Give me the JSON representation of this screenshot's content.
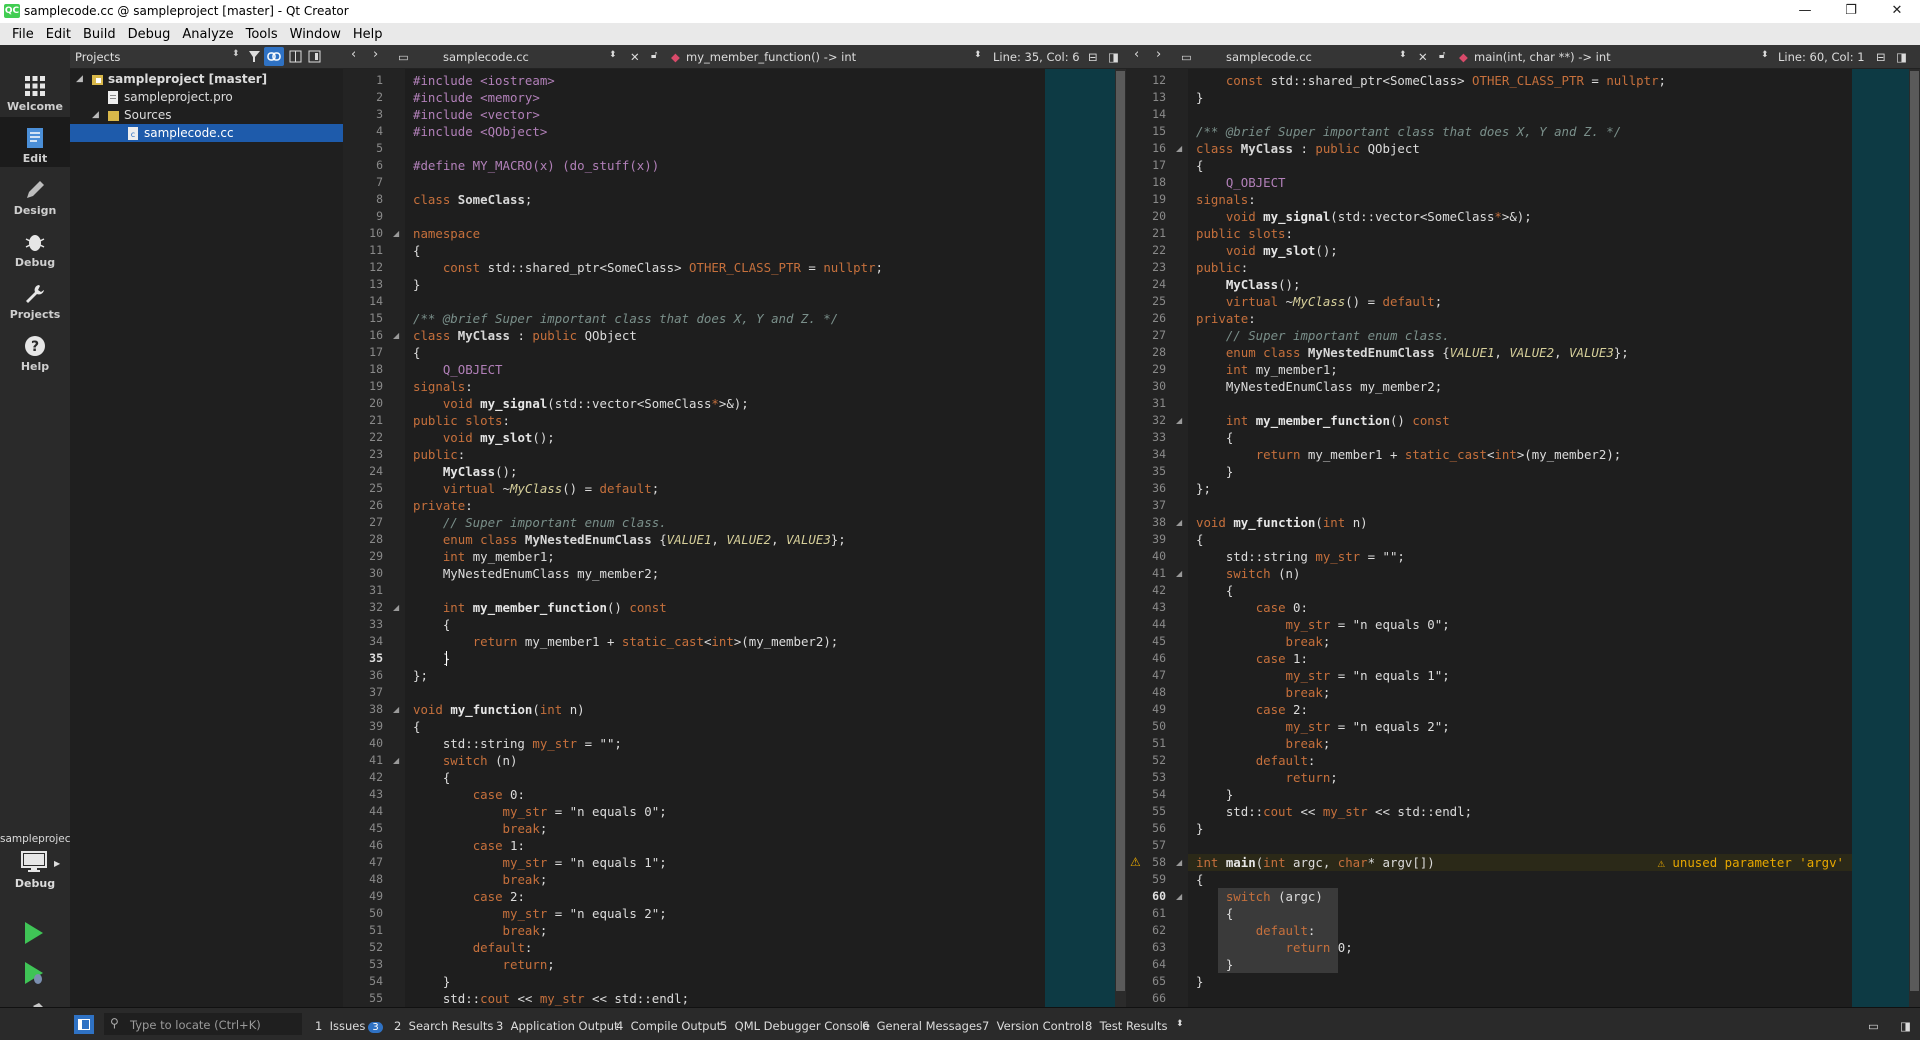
{
  "window": {
    "title": "samplecode.cc @ sampleproject [master] - Qt Creator",
    "app_icon": "QC",
    "controls": {
      "minimize": "—",
      "maximize": "❐",
      "close": "✕"
    }
  },
  "menu": [
    "File",
    "Edit",
    "Build",
    "Debug",
    "Analyze",
    "Tools",
    "Window",
    "Help"
  ],
  "modes": [
    {
      "label": "Welcome",
      "icon": "grid-icon"
    },
    {
      "label": "Edit",
      "icon": "edit-doc-icon",
      "active": true
    },
    {
      "label": "Design",
      "icon": "pencil-icon"
    },
    {
      "label": "Debug",
      "icon": "bug-icon"
    },
    {
      "label": "Projects",
      "icon": "wrench-icon"
    },
    {
      "label": "Help",
      "icon": "help-icon"
    }
  ],
  "kit": {
    "project": "sampleproject",
    "config": "Debug"
  },
  "projects_panel": {
    "title": "Projects",
    "tree": [
      {
        "label": "sampleproject [master]",
        "depth": 0,
        "bold": true,
        "expanded": true,
        "icon": "project-folder-icon"
      },
      {
        "label": "sampleproject.pro",
        "depth": 1,
        "icon": "pro-file-icon"
      },
      {
        "label": "Sources",
        "depth": 1,
        "expanded": true,
        "icon": "folder-icon"
      },
      {
        "label": "samplecode.cc",
        "depth": 2,
        "selected": true,
        "icon": "cpp-file-icon"
      }
    ]
  },
  "editors": [
    {
      "file": "samplecode.cc",
      "symbol": "my_member_function() -> int",
      "position": "Line: 35, Col: 6",
      "current_line": 35,
      "first_line": 1
    },
    {
      "file": "samplecode.cc",
      "symbol": "main(int, char **) -> int",
      "position": "Line: 60, Col: 1",
      "current_line": 60,
      "first_line": 12,
      "warning": "unused parameter 'argv'",
      "warning_line": 58
    }
  ],
  "status": {
    "locator_placeholder": "Type to locate (Ctrl+K)",
    "panes": [
      {
        "n": "1",
        "label": "Issues",
        "badge": "3"
      },
      {
        "n": "2",
        "label": "Search Results"
      },
      {
        "n": "3",
        "label": "Application Output"
      },
      {
        "n": "4",
        "label": "Compile Output"
      },
      {
        "n": "5",
        "label": "QML Debugger Console"
      },
      {
        "n": "6",
        "label": "General Messages"
      },
      {
        "n": "7",
        "label": "Version Control"
      },
      {
        "n": "8",
        "label": "Test Results"
      }
    ]
  },
  "code_lines": [
    [
      [
        "pp",
        "#include <iostream>"
      ]
    ],
    [
      [
        "pp",
        "#include <memory>"
      ]
    ],
    [
      [
        "pp",
        "#include <vector>"
      ]
    ],
    [
      [
        "pp",
        "#include <QObject>"
      ]
    ],
    [],
    [
      [
        "pp",
        "#define MY_MACRO(x) (do_stuff(x))"
      ]
    ],
    [],
    [
      [
        "k",
        "class "
      ],
      [
        "cls",
        "SomeClass"
      ],
      [
        "plain",
        ";"
      ]
    ],
    [],
    [
      [
        "k",
        "namespace"
      ]
    ],
    [
      [
        "plain",
        "{"
      ]
    ],
    [
      [
        "plain",
        "    "
      ],
      [
        "k",
        "const "
      ],
      [
        "plain",
        "std::shared_ptr<SomeClass> "
      ],
      [
        "var",
        "OTHER_CLASS_PTR"
      ],
      [
        "plain",
        " = "
      ],
      [
        "k",
        "nullptr"
      ],
      [
        "plain",
        ";"
      ]
    ],
    [
      [
        "plain",
        "}"
      ]
    ],
    [],
    [
      [
        "cm",
        "/** @brief Super important class that does X, Y and Z. */"
      ]
    ],
    [
      [
        "k",
        "class "
      ],
      [
        "cls",
        "MyClass"
      ],
      [
        "plain",
        " : "
      ],
      [
        "k",
        "public "
      ],
      [
        "plain",
        "QObject"
      ]
    ],
    [
      [
        "plain",
        "{"
      ]
    ],
    [
      [
        "plain",
        "    "
      ],
      [
        "mac",
        "Q_OBJECT"
      ]
    ],
    [
      [
        "k",
        "signals"
      ],
      [
        "plain",
        ":"
      ]
    ],
    [
      [
        "plain",
        "    "
      ],
      [
        "k",
        "void "
      ],
      [
        "fn",
        "my_signal"
      ],
      [
        "plain",
        "(std::vector<SomeClass"
      ],
      [
        "k",
        "*"
      ],
      [
        "plain",
        ">&);"
      ]
    ],
    [
      [
        "k",
        "public slots"
      ],
      [
        "plain",
        ":"
      ]
    ],
    [
      [
        "plain",
        "    "
      ],
      [
        "k",
        "void "
      ],
      [
        "fn",
        "my_slot"
      ],
      [
        "plain",
        "();"
      ]
    ],
    [
      [
        "k",
        "public"
      ],
      [
        "plain",
        ":"
      ]
    ],
    [
      [
        "plain",
        "    "
      ],
      [
        "fn",
        "MyClass"
      ],
      [
        "plain",
        "();"
      ]
    ],
    [
      [
        "plain",
        "    "
      ],
      [
        "k",
        "virtual "
      ],
      [
        "plain",
        "~"
      ],
      [
        "en",
        "MyClass"
      ],
      [
        "plain",
        "() = "
      ],
      [
        "k",
        "default"
      ],
      [
        "plain",
        ";"
      ]
    ],
    [
      [
        "k",
        "private"
      ],
      [
        "plain",
        ":"
      ]
    ],
    [
      [
        "plain",
        "    "
      ],
      [
        "cm",
        "// Super important enum class."
      ]
    ],
    [
      [
        "plain",
        "    "
      ],
      [
        "k",
        "enum class "
      ],
      [
        "cls",
        "MyNestedEnumClass"
      ],
      [
        "plain",
        " {"
      ],
      [
        "en",
        "VALUE1"
      ],
      [
        "plain",
        ", "
      ],
      [
        "en",
        "VALUE2"
      ],
      [
        "plain",
        ", "
      ],
      [
        "en",
        "VALUE3"
      ],
      [
        "plain",
        "};"
      ]
    ],
    [
      [
        "plain",
        "    "
      ],
      [
        "k",
        "int "
      ],
      [
        "plain",
        "my_member1;"
      ]
    ],
    [
      [
        "plain",
        "    MyNestedEnumClass my_member2;"
      ]
    ],
    [],
    [
      [
        "plain",
        "    "
      ],
      [
        "k",
        "int "
      ],
      [
        "fn",
        "my_member_function"
      ],
      [
        "plain",
        "() "
      ],
      [
        "k",
        "const"
      ]
    ],
    [
      [
        "plain",
        "    {"
      ]
    ],
    [
      [
        "plain",
        "        "
      ],
      [
        "k",
        "return "
      ],
      [
        "plain",
        "my_member1 + "
      ],
      [
        "k",
        "static_cast"
      ],
      [
        "plain",
        "<"
      ],
      [
        "k",
        "int"
      ],
      [
        "plain",
        ">(my_member2);"
      ]
    ],
    [
      [
        "plain",
        "    }"
      ]
    ],
    [
      [
        "plain",
        "};"
      ]
    ],
    [],
    [
      [
        "k",
        "void "
      ],
      [
        "fn",
        "my_function"
      ],
      [
        "plain",
        "("
      ],
      [
        "k",
        "int "
      ],
      [
        "plain",
        "n)"
      ]
    ],
    [
      [
        "plain",
        "{"
      ]
    ],
    [
      [
        "plain",
        "    std::string "
      ],
      [
        "var",
        "my_str"
      ],
      [
        "plain",
        " = \"\";"
      ]
    ],
    [
      [
        "plain",
        "    "
      ],
      [
        "k",
        "switch "
      ],
      [
        "plain",
        "(n)"
      ]
    ],
    [
      [
        "plain",
        "    {"
      ]
    ],
    [
      [
        "plain",
        "        "
      ],
      [
        "k",
        "case "
      ],
      [
        "plain",
        "0:"
      ]
    ],
    [
      [
        "plain",
        "            "
      ],
      [
        "var",
        "my_str"
      ],
      [
        "plain",
        " = \"n equals 0\";"
      ]
    ],
    [
      [
        "plain",
        "            "
      ],
      [
        "k",
        "break"
      ],
      [
        "plain",
        ";"
      ]
    ],
    [
      [
        "plain",
        "        "
      ],
      [
        "k",
        "case "
      ],
      [
        "plain",
        "1:"
      ]
    ],
    [
      [
        "plain",
        "            "
      ],
      [
        "var",
        "my_str"
      ],
      [
        "plain",
        " = \"n equals 1\";"
      ]
    ],
    [
      [
        "plain",
        "            "
      ],
      [
        "k",
        "break"
      ],
      [
        "plain",
        ";"
      ]
    ],
    [
      [
        "plain",
        "        "
      ],
      [
        "k",
        "case "
      ],
      [
        "plain",
        "2:"
      ]
    ],
    [
      [
        "plain",
        "            "
      ],
      [
        "var",
        "my_str"
      ],
      [
        "plain",
        " = \"n equals 2\";"
      ]
    ],
    [
      [
        "plain",
        "            "
      ],
      [
        "k",
        "break"
      ],
      [
        "plain",
        ";"
      ]
    ],
    [
      [
        "plain",
        "        "
      ],
      [
        "k",
        "default"
      ],
      [
        "plain",
        ":"
      ]
    ],
    [
      [
        "plain",
        "            "
      ],
      [
        "k",
        "return"
      ],
      [
        "plain",
        ";"
      ]
    ],
    [
      [
        "plain",
        "    }"
      ]
    ],
    [
      [
        "plain",
        "    std::"
      ],
      [
        "var",
        "cout"
      ],
      [
        "plain",
        " << "
      ],
      [
        "var",
        "my_str"
      ],
      [
        "plain",
        " << std::endl;"
      ]
    ],
    [
      [
        "plain",
        "}"
      ]
    ],
    [],
    [
      [
        "k",
        "int "
      ],
      [
        "fn",
        "main"
      ],
      [
        "plain",
        "("
      ],
      [
        "k",
        "int "
      ],
      [
        "plain",
        "argc, "
      ],
      [
        "k",
        "char"
      ],
      [
        "plain",
        "* "
      ],
      [
        "plain",
        "argv[])"
      ]
    ],
    [
      [
        "plain",
        "{"
      ]
    ],
    [
      [
        "plain",
        "    "
      ],
      [
        "k",
        "switch "
      ],
      [
        "plain",
        "(argc)"
      ]
    ],
    [
      [
        "plain",
        "    {"
      ]
    ],
    [
      [
        "plain",
        "        "
      ],
      [
        "k",
        "default"
      ],
      [
        "plain",
        ":"
      ]
    ],
    [
      [
        "plain",
        "            "
      ],
      [
        "k",
        "return "
      ],
      [
        "plain",
        "0;"
      ]
    ],
    [
      [
        "plain",
        "    }"
      ]
    ],
    [
      [
        "plain",
        "}"
      ]
    ],
    []
  ],
  "fold_lines": [
    10,
    16,
    32,
    38,
    41,
    58,
    60
  ],
  "colors": {
    "accent": "#1e5bab",
    "warning": "#e6a700",
    "minimap": "#0d3a44"
  }
}
